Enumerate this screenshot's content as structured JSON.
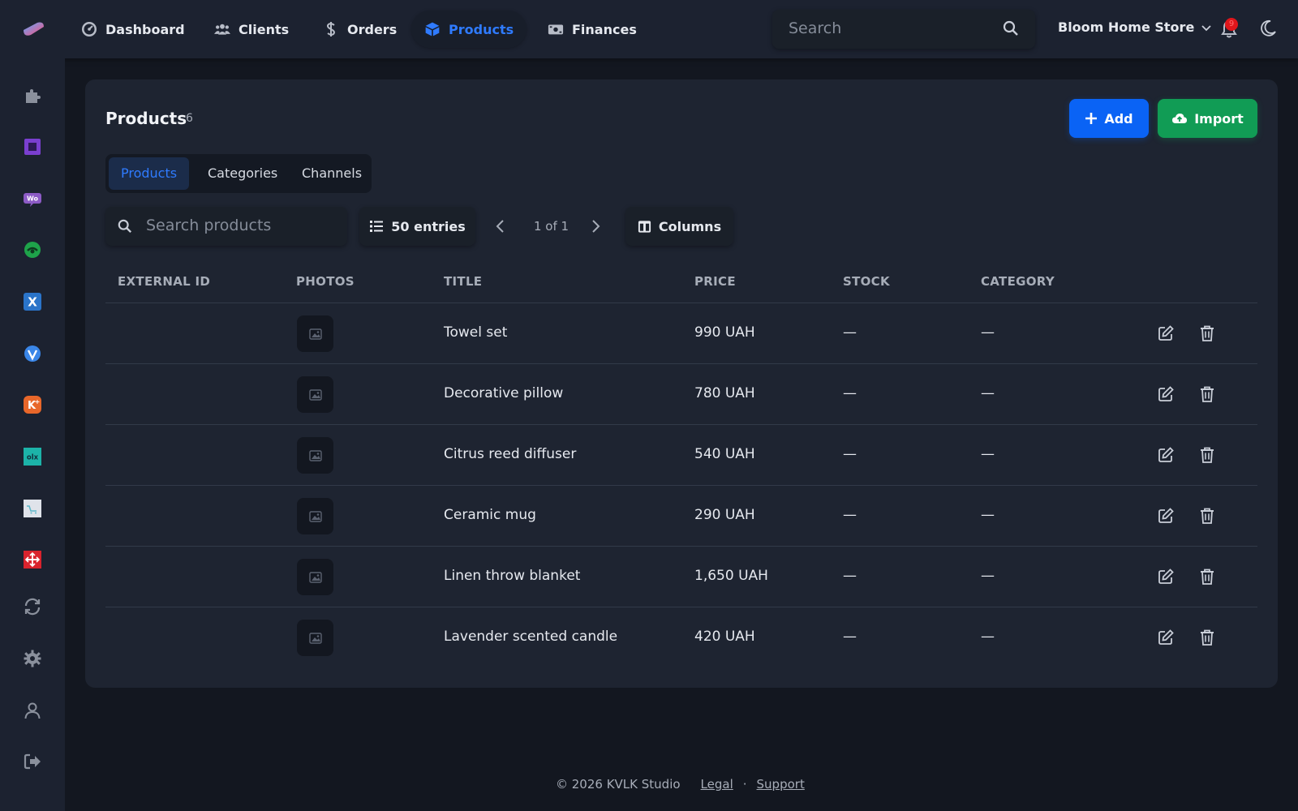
{
  "nav": {
    "items": [
      {
        "label": "Dashboard",
        "icon": "dashboard-gauge-icon"
      },
      {
        "label": "Clients",
        "icon": "users-icon"
      },
      {
        "label": "Orders",
        "icon": "dollar-icon"
      },
      {
        "label": "Products",
        "icon": "box-icon",
        "active": true
      },
      {
        "label": "Finances",
        "icon": "money-icon"
      }
    ],
    "search_placeholder": "Search",
    "store_name": "Bloom Home Store",
    "notification_count": "9"
  },
  "sidebar": {
    "items": [
      "puzzle-icon",
      "square-integration-icon",
      "woo-icon",
      "green-logo-icon",
      "x-logo-icon",
      "shield-logo-icon",
      "k-plus-icon",
      "olx-icon",
      "cart-logo-icon",
      "arrows-logo-icon",
      "sync-icon",
      "gear-icon",
      "user-icon",
      "logout-icon"
    ]
  },
  "page": {
    "title": "Products",
    "count": "6",
    "add_label": "Add",
    "import_label": "Import",
    "tabs": [
      "Products",
      "Categories",
      "Channels"
    ],
    "active_tab": "Products",
    "search_placeholder": "Search products",
    "entries_label": "50 entries",
    "pagination": "1 of 1",
    "columns_label": "Columns"
  },
  "table": {
    "headers": [
      "EXTERNAL ID",
      "PHOTOS",
      "TITLE",
      "PRICE",
      "STOCK",
      "CATEGORY"
    ],
    "rows": [
      {
        "external_id": "",
        "title": "Towel set",
        "price": "990 UAH",
        "stock": "—",
        "category": "—"
      },
      {
        "external_id": "",
        "title": "Decorative pillow",
        "price": "780 UAH",
        "stock": "—",
        "category": "—"
      },
      {
        "external_id": "",
        "title": "Citrus reed diffuser",
        "price": "540 UAH",
        "stock": "—",
        "category": "—"
      },
      {
        "external_id": "",
        "title": "Ceramic mug",
        "price": "290 UAH",
        "stock": "—",
        "category": "—"
      },
      {
        "external_id": "",
        "title": "Linen throw blanket",
        "price": "1,650 UAH",
        "stock": "—",
        "category": "—"
      },
      {
        "external_id": "",
        "title": "Lavender scented candle",
        "price": "420 UAH",
        "stock": "—",
        "category": "—"
      }
    ]
  },
  "footer": {
    "copyright": "© 2026 KVLK Studio",
    "legal": "Legal",
    "separator": "·",
    "support": "Support"
  },
  "colors": {
    "accent": "#2f7bff",
    "add_button": "#0a63f5",
    "import_button": "#119c55",
    "background": "#131720",
    "surface": "#1e2431"
  }
}
